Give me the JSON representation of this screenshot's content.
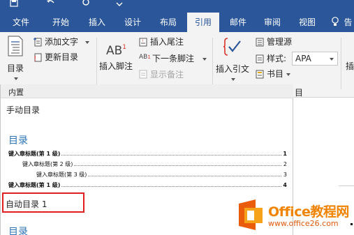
{
  "tabs": [
    "文件",
    "开始",
    "插入",
    "设计",
    "布局",
    "引用",
    "邮件",
    "审阅",
    "视图",
    "告"
  ],
  "active_tab": "引用",
  "ribbon": {
    "toc_button": "目录",
    "add_text": "添加文字",
    "update_toc": "更新目录",
    "insert_footnote": "插入脚注",
    "insert_endnote": "插入尾注",
    "next_footnote": "下一条脚注",
    "show_notes": "显示备注",
    "insert_citation": "插入引文",
    "manage_sources": "管理源",
    "style_label": "样式:",
    "style_value": "APA",
    "bibliography": "书目",
    "citations_group": "目",
    "insert_caption_partial": "插"
  },
  "gallery": {
    "header": "内置",
    "manual_toc": "手动目录",
    "toc_title": "目录",
    "entries": [
      {
        "text": "键入章标题(第 1 级)",
        "page": "1"
      },
      {
        "text": "键入章标题(第 2 级)",
        "page": "2"
      },
      {
        "text": "键入章标题(第 3 级)",
        "page": "3"
      },
      {
        "text": "键入章标题(第 1 级)",
        "page": "4"
      }
    ],
    "auto_toc_1": "自动目录 1",
    "toc_title_2": "目录"
  },
  "watermark": {
    "title": "Office教程网",
    "url": "www.office26.com",
    "brand_color": "#f08300"
  },
  "colors": {
    "ribbon_blue": "#2b579a",
    "heading_blue": "#2e74b5",
    "highlight_red": "#e02020"
  }
}
